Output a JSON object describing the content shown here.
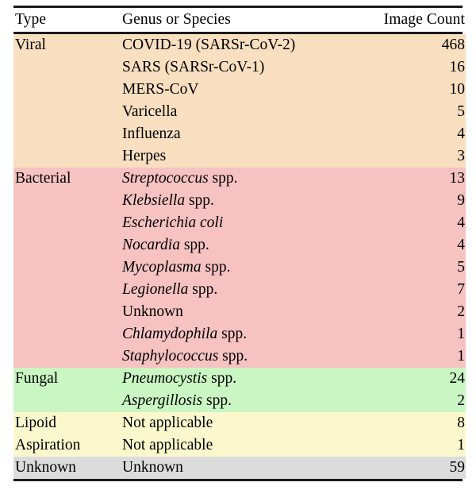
{
  "table": {
    "headers": {
      "type": "Type",
      "genus": "Genus or Species",
      "count": "Image Count"
    },
    "colors": {
      "viral": "#f8dfc0",
      "bacterial": "#f6c2c2",
      "fungal": "#c9f6c2",
      "lipoid": "#fbf8cd",
      "unknown": "#dcdcdc",
      "rule": "#1a1a1a",
      "text": "#000000",
      "page_background": "#ffffff"
    },
    "sections": [
      {
        "type_label": "Viral",
        "band": "viral",
        "rows": [
          {
            "genus": "COVID-19 (SARSr-CoV-2)",
            "genus_italic": "",
            "genus_suffix": "COVID-19 (SARSr-CoV-2)",
            "count": "468"
          },
          {
            "genus": "SARS (SARSr-CoV-1)",
            "genus_italic": "",
            "genus_suffix": "SARS (SARSr-CoV-1)",
            "count": "16"
          },
          {
            "genus": "MERS-CoV",
            "genus_italic": "",
            "genus_suffix": "MERS-CoV",
            "count": "10"
          },
          {
            "genus": "Varicella",
            "genus_italic": "",
            "genus_suffix": "Varicella",
            "count": "5"
          },
          {
            "genus": "Influenza",
            "genus_italic": "",
            "genus_suffix": "Influenza",
            "count": "4"
          },
          {
            "genus": "Herpes",
            "genus_italic": "",
            "genus_suffix": "Herpes",
            "count": "3"
          }
        ]
      },
      {
        "type_label": "Bacterial",
        "band": "bacterial",
        "rows": [
          {
            "genus": "Streptococcus spp.",
            "genus_italic": "Streptococcus",
            "genus_suffix": " spp.",
            "count": "13"
          },
          {
            "genus": "Klebsiella spp.",
            "genus_italic": "Klebsiella",
            "genus_suffix": " spp.",
            "count": "9"
          },
          {
            "genus": "Escherichia coli",
            "genus_italic": "Escherichia coli",
            "genus_suffix": "",
            "count": "4"
          },
          {
            "genus": "Nocardia spp.",
            "genus_italic": "Nocardia",
            "genus_suffix": " spp.",
            "count": "4"
          },
          {
            "genus": "Mycoplasma spp.",
            "genus_italic": "Mycoplasma",
            "genus_suffix": " spp.",
            "count": "5"
          },
          {
            "genus": "Legionella spp.",
            "genus_italic": "Legionella",
            "genus_suffix": " spp.",
            "count": "7"
          },
          {
            "genus": "Unknown",
            "genus_italic": "",
            "genus_suffix": "Unknown",
            "count": "2"
          },
          {
            "genus": "Chlamydophila spp.",
            "genus_italic": "Chlamydophila",
            "genus_suffix": " spp.",
            "count": "1"
          },
          {
            "genus": "Staphylococcus spp.",
            "genus_italic": "Staphylococcus",
            "genus_suffix": " spp.",
            "count": "1"
          }
        ]
      },
      {
        "type_label": "Fungal",
        "band": "fungal",
        "rows": [
          {
            "genus": "Pneumocystis spp.",
            "genus_italic": "Pneumocystis",
            "genus_suffix": " spp.",
            "count": "24"
          },
          {
            "genus": "Aspergillosis spp.",
            "genus_italic": "Aspergillosis",
            "genus_suffix": " spp.",
            "count": "2"
          }
        ]
      },
      {
        "type_label": "Lipoid",
        "band": "lipoid",
        "rows": [
          {
            "genus": "Not applicable",
            "genus_italic": "",
            "genus_suffix": "Not applicable",
            "count": "8"
          }
        ]
      },
      {
        "type_label": "Aspiration",
        "band": "lipoid",
        "rows": [
          {
            "genus": "Not applicable",
            "genus_italic": "",
            "genus_suffix": "Not applicable",
            "count": "1"
          }
        ]
      },
      {
        "type_label": "Unknown",
        "band": "unknown",
        "rows": [
          {
            "genus": "Unknown",
            "genus_italic": "",
            "genus_suffix": "Unknown",
            "count": "59"
          }
        ]
      }
    ]
  }
}
